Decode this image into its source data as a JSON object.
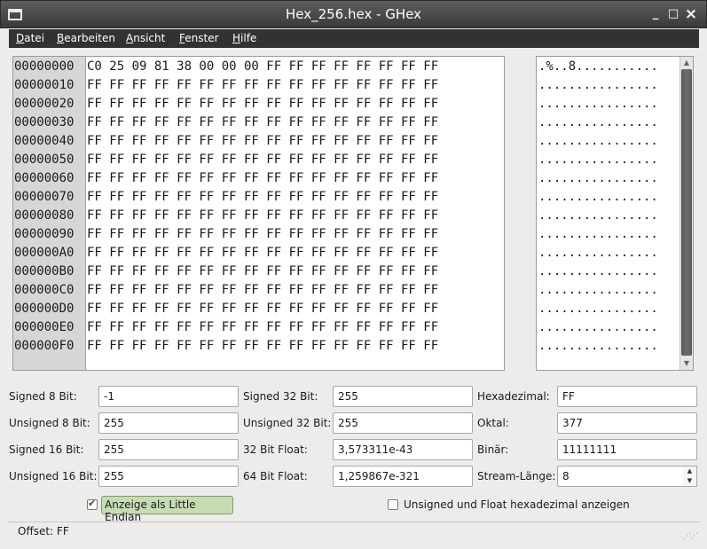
{
  "window": {
    "title": "Hex_256.hex - GHex",
    "minimize": "_",
    "maximize": "□",
    "close": "×"
  },
  "menu": [
    "Datei",
    "Bearbeiten",
    "Ansicht",
    "Fenster",
    "Hilfe"
  ],
  "hex": {
    "offsets": [
      "00000000",
      "00000010",
      "00000020",
      "00000030",
      "00000040",
      "00000050",
      "00000060",
      "00000070",
      "00000080",
      "00000090",
      "000000A0",
      "000000B0",
      "000000C0",
      "000000D0",
      "000000E0",
      "000000F0"
    ],
    "rows": [
      "C0 25 09 81 38 00 00 00 FF FF FF FF FF FF FF FF",
      "FF FF FF FF FF FF FF FF FF FF FF FF FF FF FF FF",
      "FF FF FF FF FF FF FF FF FF FF FF FF FF FF FF FF",
      "FF FF FF FF FF FF FF FF FF FF FF FF FF FF FF FF",
      "FF FF FF FF FF FF FF FF FF FF FF FF FF FF FF FF",
      "FF FF FF FF FF FF FF FF FF FF FF FF FF FF FF FF",
      "FF FF FF FF FF FF FF FF FF FF FF FF FF FF FF FF",
      "FF FF FF FF FF FF FF FF FF FF FF FF FF FF FF FF",
      "FF FF FF FF FF FF FF FF FF FF FF FF FF FF FF FF",
      "FF FF FF FF FF FF FF FF FF FF FF FF FF FF FF FF",
      "FF FF FF FF FF FF FF FF FF FF FF FF FF FF FF FF",
      "FF FF FF FF FF FF FF FF FF FF FF FF FF FF FF FF",
      "FF FF FF FF FF FF FF FF FF FF FF FF FF FF FF FF",
      "FF FF FF FF FF FF FF FF FF FF FF FF FF FF FF FF",
      "FF FF FF FF FF FF FF FF FF FF FF FF FF FF FF FF",
      "FF FF FF FF FF FF FF FF FF FF FF FF FF FF FF FF"
    ],
    "ascii": [
      ".%..8...........",
      "................",
      "................",
      "................",
      "................",
      "................",
      "................",
      "................",
      "................",
      "................",
      "................",
      "................",
      "................",
      "................",
      "................",
      "................"
    ]
  },
  "converter": {
    "signed8": {
      "label": "Signed 8 Bit:",
      "value": "-1"
    },
    "unsigned8": {
      "label": "Unsigned 8 Bit:",
      "value": "255"
    },
    "signed16": {
      "label": "Signed 16 Bit:",
      "value": "255"
    },
    "unsigned16": {
      "label": "Unsigned 16 Bit:",
      "value": "255"
    },
    "signed32": {
      "label": "Signed 32 Bit:",
      "value": "255"
    },
    "unsigned32": {
      "label": "Unsigned 32 Bit:",
      "value": "255"
    },
    "float32": {
      "label": "32 Bit Float:",
      "value": "3,573311e-43"
    },
    "float64": {
      "label": "64 Bit Float:",
      "value": "1,259867e-321"
    },
    "hex": {
      "label": "Hexadezimal:",
      "value": "FF"
    },
    "octal": {
      "label": "Oktal:",
      "value": "377"
    },
    "binary": {
      "label": "Binär:",
      "value": "11111111"
    },
    "stream_length": {
      "label": "Stream-Länge:",
      "value": "8"
    }
  },
  "options": {
    "little_endian": {
      "label": "Anzeige als Little Endian",
      "checked": true
    },
    "unsigned_float_hex": {
      "label": "Unsigned und Float hexadezimal anzeigen",
      "checked": false
    }
  },
  "status": {
    "offset": "Offset: FF"
  }
}
